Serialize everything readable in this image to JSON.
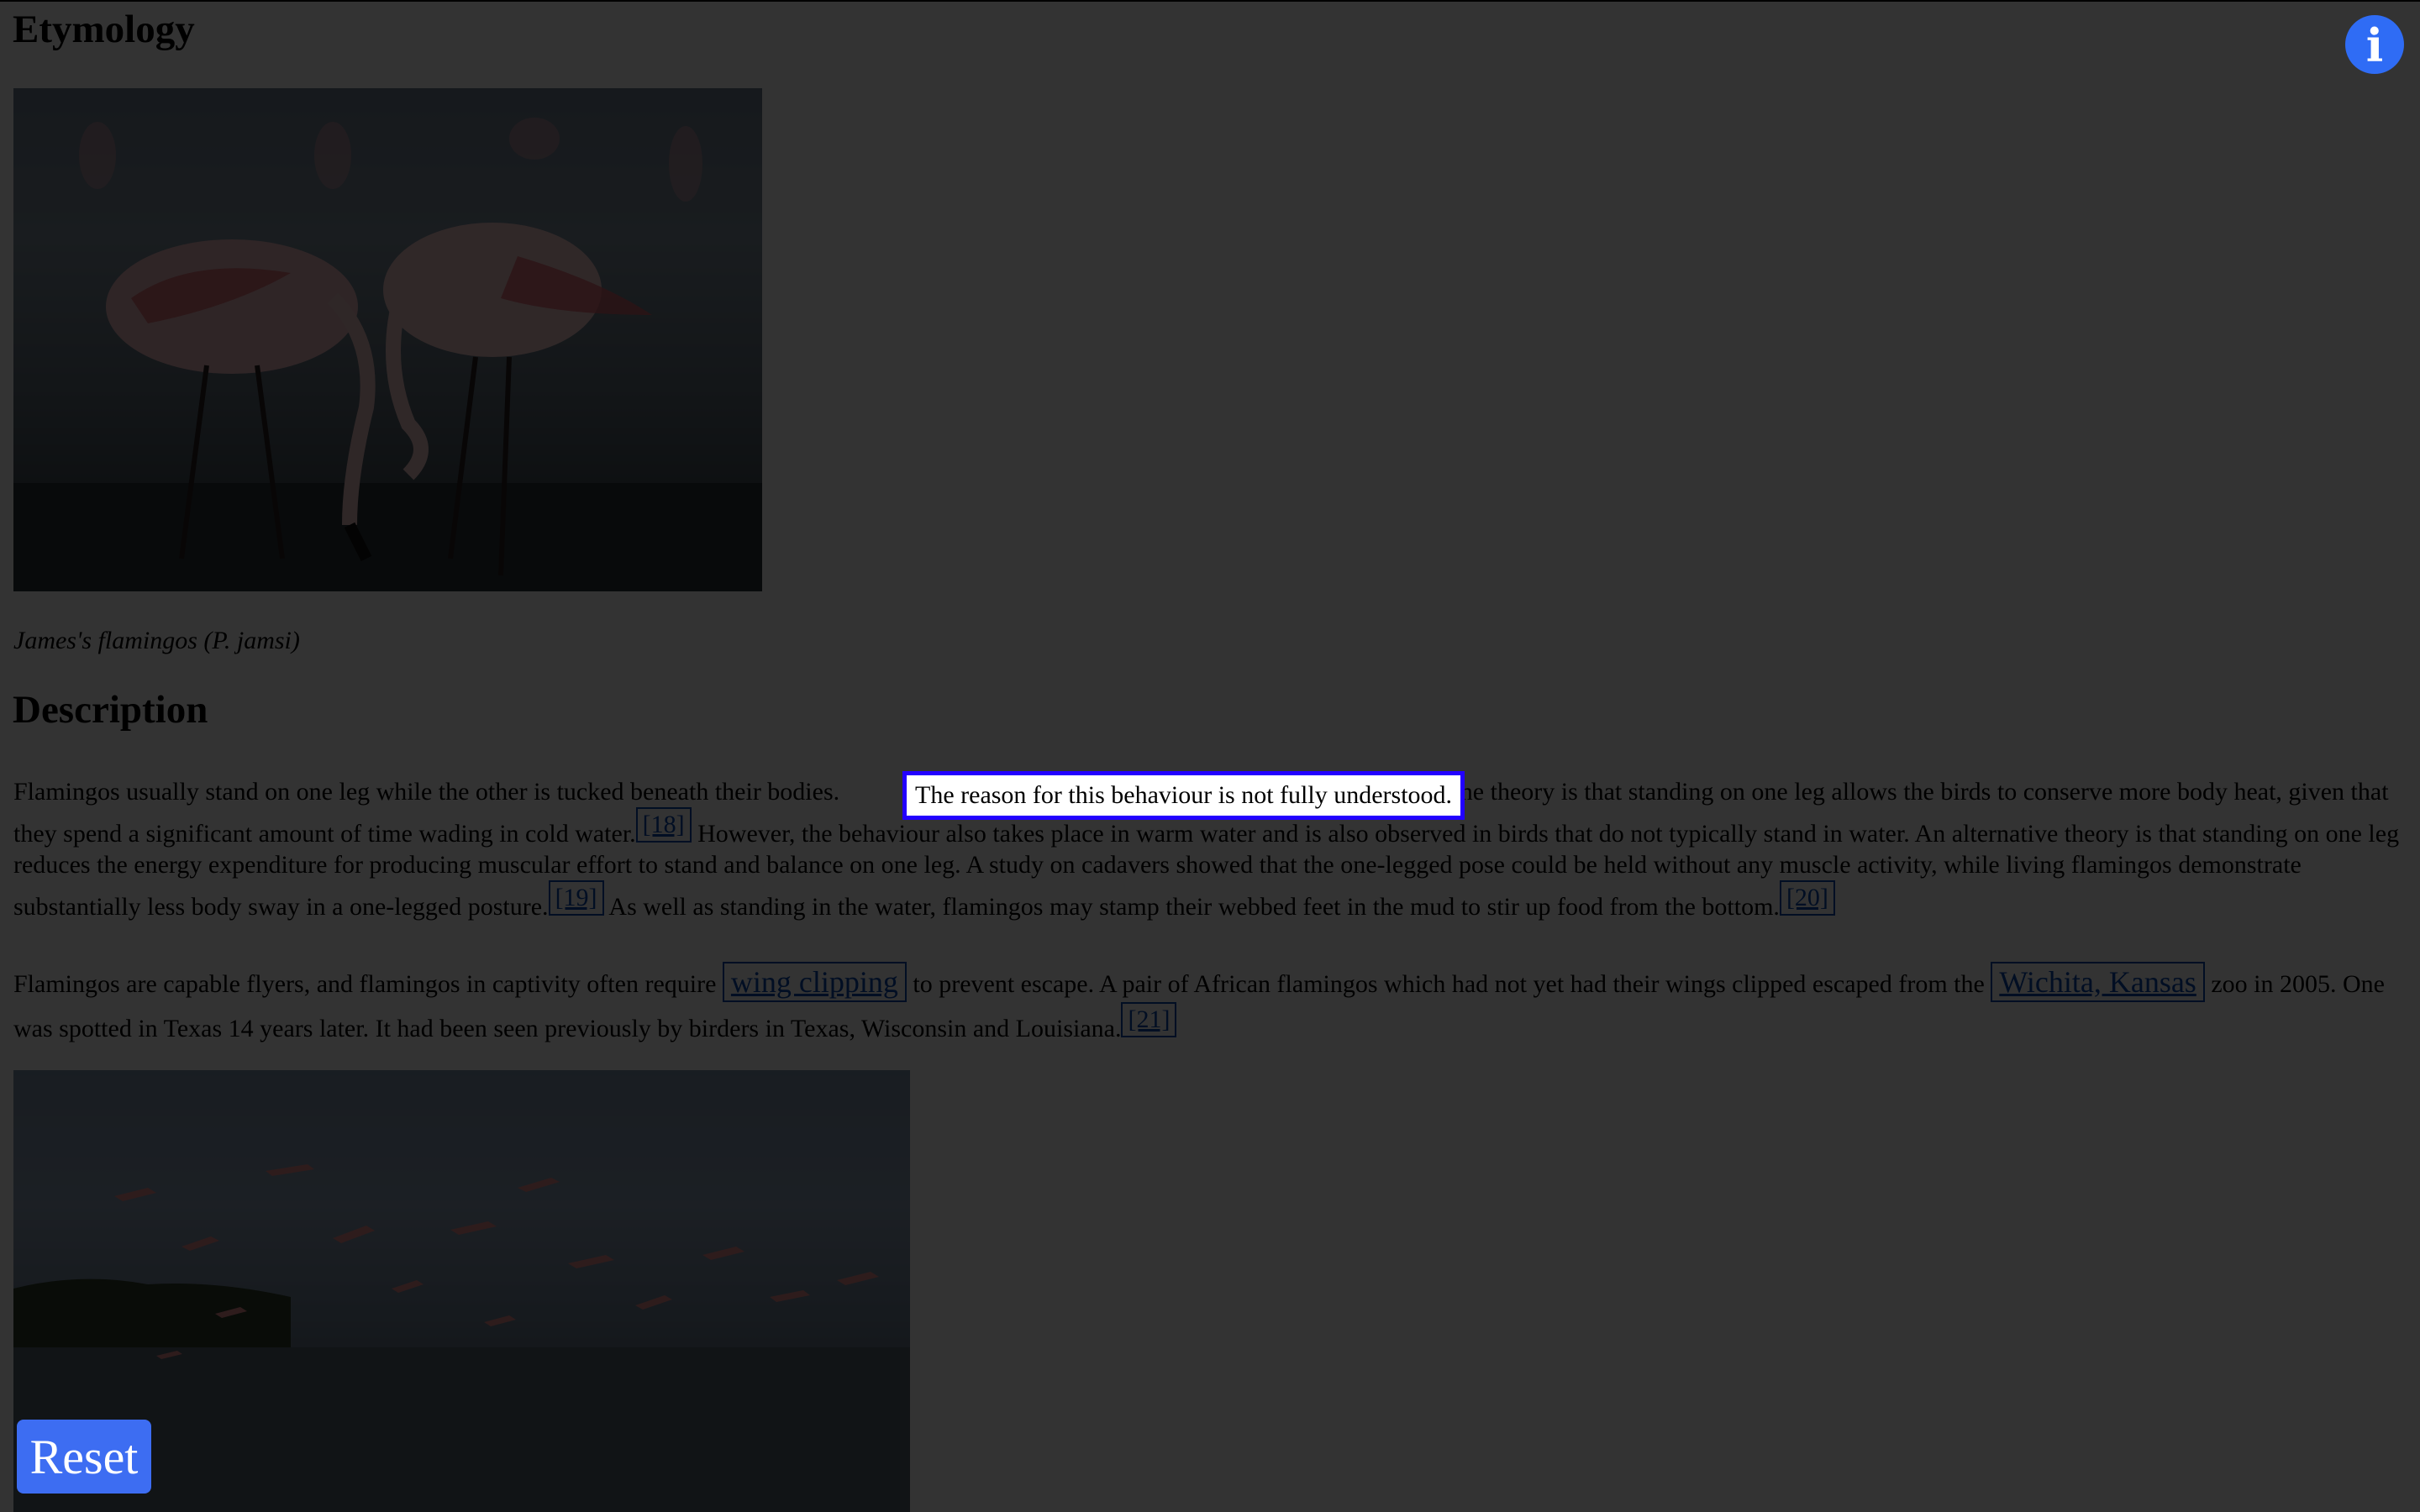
{
  "headings": {
    "etymology": "Etymology",
    "description": "Description"
  },
  "figure1": {
    "caption": "James's flamingos (P. jamsi)"
  },
  "description": {
    "p1_before": "Flamingos usually stand on one leg while the other is tucked beneath their bodies.",
    "p1_highlight": "The reason for this behaviour is not fully understood.",
    "p1_after": "One theory is that standing on one leg allows the birds to conserve more body heat, given that they spend a significant amount of time wading in cold water.",
    "cite18": "[18]",
    "p1_mid": "However, the behaviour also takes place in warm water and is also observed in birds that do not typically stand in water. An alternative theory is that standing on one leg reduces the energy expenditure for producing muscular effort to stand and balance on one leg. A study on cadavers showed that the one-legged pose could be held without any muscle activity, while living flamingos demonstrate substantially less body sway in a one-legged posture.",
    "cite19": "[19]",
    "p1_end": "As well as standing in the water, flamingos may stamp their webbed feet in the mud to stir up food from the bottom.",
    "cite20": "[20]",
    "p2_a": "Flamingos are capable flyers, and flamingos in captivity often require",
    "link_wing": "wing clipping",
    "p2_b": "to prevent escape. A pair of African flamingos which had not yet had their wings clipped escaped from the",
    "link_wichita": "Wichita, Kansas",
    "p2_c": "zoo in 2005. One was spotted in Texas 14 years later. It had been seen previously by birders in Texas, Wisconsin and Louisiana.",
    "cite21": "[21]"
  },
  "controls": {
    "info_label": "i",
    "reset_label": "Reset"
  },
  "colors": {
    "highlight_border": "#2200ff",
    "button_blue": "#3d6df2",
    "link_blue": "#0645ad",
    "overlay": "rgba(0,0,0,0.80)"
  }
}
